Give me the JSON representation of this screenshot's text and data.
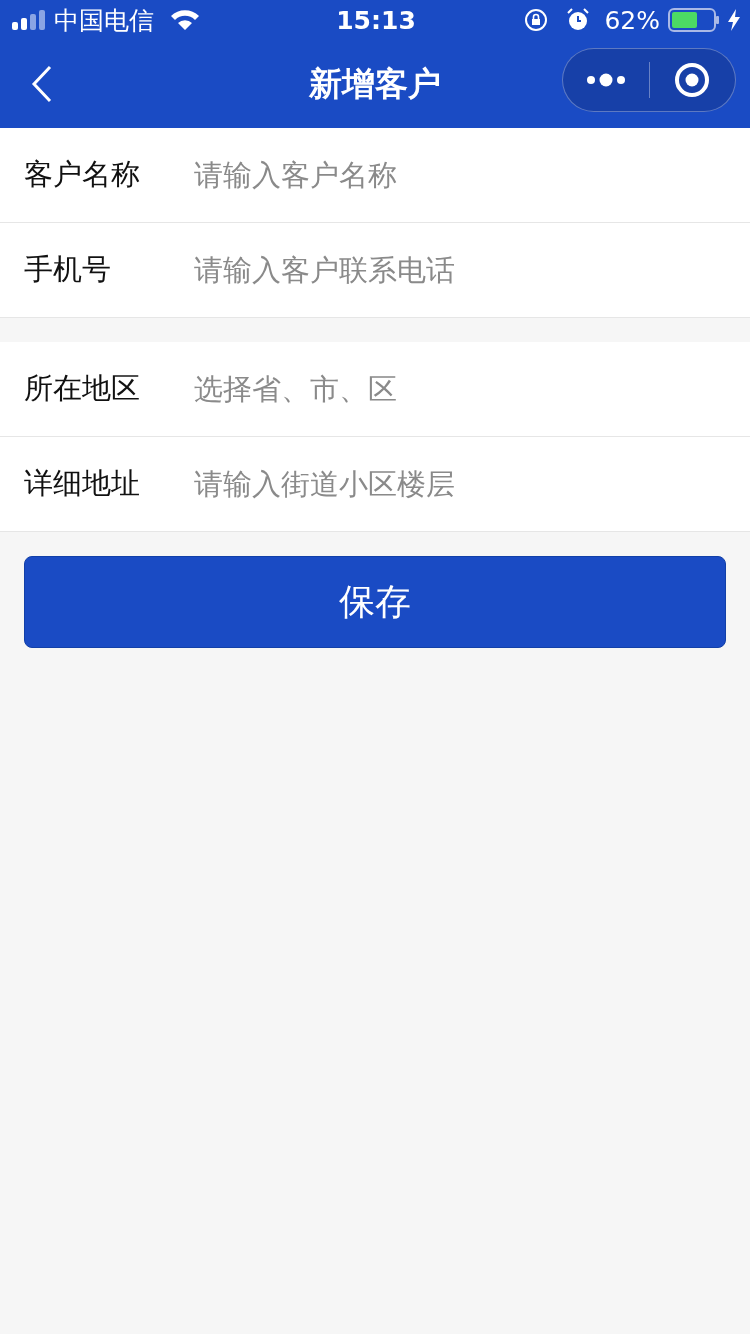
{
  "status_bar": {
    "carrier": "中国电信",
    "time": "15:13",
    "battery": "62%"
  },
  "nav": {
    "title": "新增客户"
  },
  "groups": [
    {
      "fields": [
        {
          "label": "客户名称",
          "placeholder": "请输入客户名称"
        },
        {
          "label": "手机号",
          "placeholder": "请输入客户联系电话"
        }
      ]
    },
    {
      "fields": [
        {
          "label": "所在地区",
          "placeholder": "选择省、市、区"
        },
        {
          "label": "详细地址",
          "placeholder": "请输入街道小区楼层"
        }
      ]
    }
  ],
  "save_button": "保存"
}
